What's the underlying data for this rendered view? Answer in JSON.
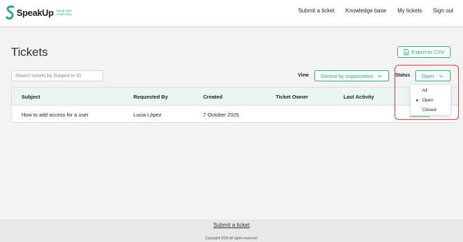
{
  "brand": {
    "name": "SpeakUp",
    "tagline": "Doing right, made easy",
    "accent": "#2bb07f"
  },
  "nav": {
    "items": [
      "Submit a ticket",
      "Knowledge base",
      "My tickets",
      "Sign out"
    ]
  },
  "page": {
    "title": "Tickets"
  },
  "toolbar": {
    "export_label": "Export to CSV",
    "search_placeholder": "Search tickets by Subject or ID",
    "view_label": "View",
    "view_value": "Owned by organization",
    "status_label": "Status",
    "status_value": "Open"
  },
  "status_dropdown": {
    "options": [
      "All",
      "Open",
      "Closed"
    ],
    "selected": "Open"
  },
  "table": {
    "columns": [
      "Subject",
      "Requested By",
      "Created",
      "Ticket Owner",
      "Last Activity"
    ],
    "rows": [
      {
        "subject": "How to add access for a user",
        "requested_by": "Lucia López",
        "created": "7 October 2025",
        "owner": "",
        "last_activity": ""
      }
    ]
  },
  "footer": {
    "link": "Submit a ticket",
    "copyright": "Copyright 2025 All rights reserved."
  }
}
